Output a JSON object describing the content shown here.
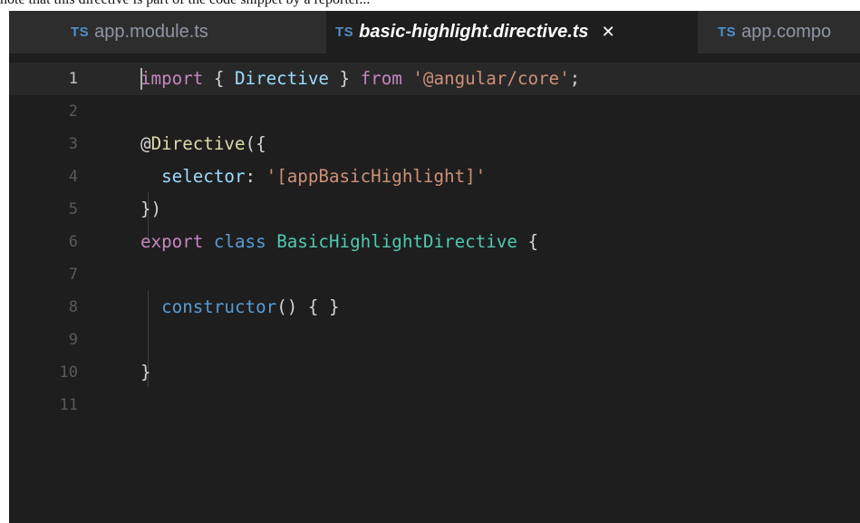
{
  "page_snippet": "note that this directive is part of the code snippet by a reporter...",
  "tabs": [
    {
      "icon": "TS",
      "label": "app.module.ts",
      "active": false
    },
    {
      "icon": "TS",
      "label": "basic-highlight.directive.ts",
      "active": true,
      "close": "✕"
    },
    {
      "icon": "TS",
      "label": "app.compo",
      "active": false
    }
  ],
  "editor": {
    "current_line": 1,
    "lines": [
      {
        "n": "1",
        "tokens": [
          {
            "t": "import",
            "c": "ctl"
          },
          {
            "t": " { ",
            "c": "punc"
          },
          {
            "t": "Directive",
            "c": "prop"
          },
          {
            "t": " } ",
            "c": "punc"
          },
          {
            "t": "from",
            "c": "ctl"
          },
          {
            "t": " ",
            "c": "punc"
          },
          {
            "t": "'@angular/core'",
            "c": "str"
          },
          {
            "t": ";",
            "c": "punc"
          }
        ]
      },
      {
        "n": "2",
        "tokens": []
      },
      {
        "n": "3",
        "tokens": [
          {
            "t": "@",
            "c": "punc"
          },
          {
            "t": "Directive",
            "c": "fn"
          },
          {
            "t": "({",
            "c": "punc"
          }
        ]
      },
      {
        "n": "4",
        "tokens": [
          {
            "t": "  selector",
            "c": "prop"
          },
          {
            "t": ": ",
            "c": "punc"
          },
          {
            "t": "'[appBasicHighlight]'",
            "c": "str"
          }
        ]
      },
      {
        "n": "5",
        "tokens": [
          {
            "t": "})",
            "c": "punc"
          }
        ]
      },
      {
        "n": "6",
        "tokens": [
          {
            "t": "export",
            "c": "ctl"
          },
          {
            "t": " ",
            "c": "punc"
          },
          {
            "t": "class",
            "c": "kw"
          },
          {
            "t": " ",
            "c": "punc"
          },
          {
            "t": "BasicHighlightDirective",
            "c": "cls"
          },
          {
            "t": " {",
            "c": "punc"
          }
        ]
      },
      {
        "n": "7",
        "tokens": []
      },
      {
        "n": "8",
        "tokens": [
          {
            "t": "  constructor",
            "c": "kw"
          },
          {
            "t": "() { }",
            "c": "punc"
          }
        ]
      },
      {
        "n": "9",
        "tokens": []
      },
      {
        "n": "10",
        "tokens": [
          {
            "t": "}",
            "c": "punc"
          }
        ]
      },
      {
        "n": "11",
        "tokens": []
      }
    ]
  }
}
